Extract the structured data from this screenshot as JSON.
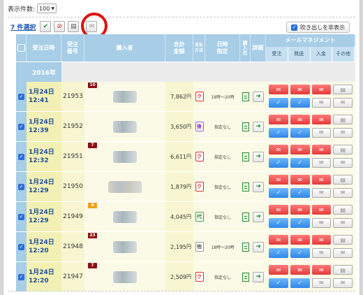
{
  "display_count": {
    "label": "表示件数:",
    "value": "100"
  },
  "toolbar": {
    "selected": "7 件選択",
    "icons": [
      "check-icon",
      "no-icon",
      "print-icon",
      "mail-icon"
    ]
  },
  "balloon_toggle": {
    "label": "吹き出しを非表示",
    "checked": true
  },
  "headers": {
    "date": "受注日時",
    "no": "受注番号",
    "buyer": "購入者",
    "total": "合計金額",
    "pay": "支払方法",
    "time": "日時指定",
    "buy_from": "購入先",
    "detail": "詳細",
    "mail": "メールマネジメント",
    "mail_sub": [
      "受注",
      "発送",
      "入金",
      "その他"
    ]
  },
  "year": "2016年",
  "rows": [
    {
      "date": "1月24日",
      "time": "12:41",
      "no": "21953",
      "badge": "10",
      "badge_color": "#8a1010",
      "total": "7,862",
      "pay": "ク",
      "pay_type": "k",
      "time_slot": "18時～20時"
    },
    {
      "date": "1月24日",
      "time": "12:39",
      "no": "21952",
      "badge": "",
      "badge_color": "",
      "total": "3,650",
      "pay": "後",
      "pay_type": "go",
      "time_slot": "指定なし"
    },
    {
      "date": "1月24日",
      "time": "12:32",
      "no": "21951",
      "badge": "7",
      "badge_color": "#8a1010",
      "total": "6,611",
      "pay": "ク",
      "pay_type": "k",
      "time_slot": "指定なし"
    },
    {
      "date": "1月24日",
      "time": "12:29",
      "no": "21950",
      "badge": "",
      "badge_color": "",
      "total": "1,879",
      "pay": "ク",
      "pay_type": "k",
      "time_slot": "指定なし"
    },
    {
      "date": "1月24日",
      "time": "12:29",
      "no": "21949",
      "badge": "4",
      "badge_color": "#f0a020",
      "total": "4,045",
      "pay": "代",
      "pay_type": "dai",
      "time_slot": "指定なし"
    },
    {
      "date": "1月24日",
      "time": "12:20",
      "no": "21948",
      "badge": "23",
      "badge_color": "#8a1010",
      "total": "2,195",
      "pay": "他",
      "pay_type": "ta",
      "time_slot": "18時～20時"
    },
    {
      "date": "1月24日",
      "time": "12:20",
      "no": "21947",
      "badge": "7",
      "badge_color": "#8a1010",
      "total": "2,509",
      "pay": "ク",
      "pay_type": "k",
      "time_slot": "指定なし"
    }
  ],
  "currency": "円"
}
